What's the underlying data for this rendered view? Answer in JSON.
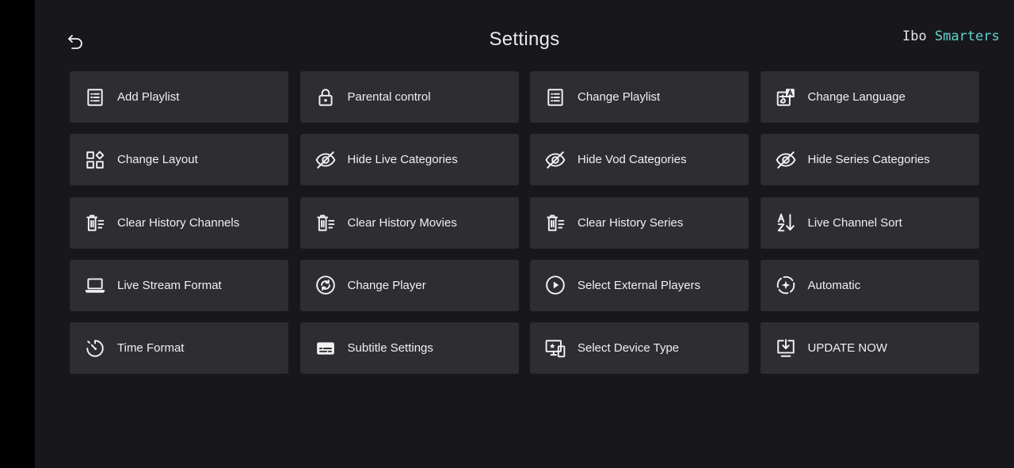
{
  "header": {
    "title": "Settings",
    "brand_part1": "Ibo",
    "brand_part2": "Smarters",
    "back_icon": "back-arrow-icon"
  },
  "colors": {
    "background": "#18181c",
    "tile": "#2d2d32",
    "text": "#f0f0f2",
    "brand_accent": "#5fd4cf"
  },
  "tiles": [
    {
      "label": "Add Playlist",
      "icon": "list-icon"
    },
    {
      "label": "Parental control",
      "icon": "lock-icon"
    },
    {
      "label": "Change Playlist",
      "icon": "list-icon"
    },
    {
      "label": "Change Language",
      "icon": "translate-icon"
    },
    {
      "label": "Change Layout",
      "icon": "layout-icon"
    },
    {
      "label": "Hide Live Categories",
      "icon": "eye-off-icon"
    },
    {
      "label": "Hide Vod Categories",
      "icon": "eye-off-icon"
    },
    {
      "label": "Hide Series Categories",
      "icon": "eye-off-icon"
    },
    {
      "label": "Clear History Channels",
      "icon": "trash-list-icon"
    },
    {
      "label": "Clear History Movies",
      "icon": "trash-list-icon"
    },
    {
      "label": "Clear History Series",
      "icon": "trash-list-icon"
    },
    {
      "label": "Live Channel Sort",
      "icon": "sort-az-icon"
    },
    {
      "label": "Live Stream Format",
      "icon": "laptop-icon"
    },
    {
      "label": "Change Player",
      "icon": "sync-circle-icon"
    },
    {
      "label": "Select External Players",
      "icon": "play-circle-icon"
    },
    {
      "label": "Automatic",
      "icon": "auto-icon"
    },
    {
      "label": "Time Format",
      "icon": "timer-icon"
    },
    {
      "label": "Subtitle Settings",
      "icon": "subtitles-icon"
    },
    {
      "label": "Select Device Type",
      "icon": "devices-icon"
    },
    {
      "label": "UPDATE NOW",
      "icon": "download-icon"
    }
  ]
}
